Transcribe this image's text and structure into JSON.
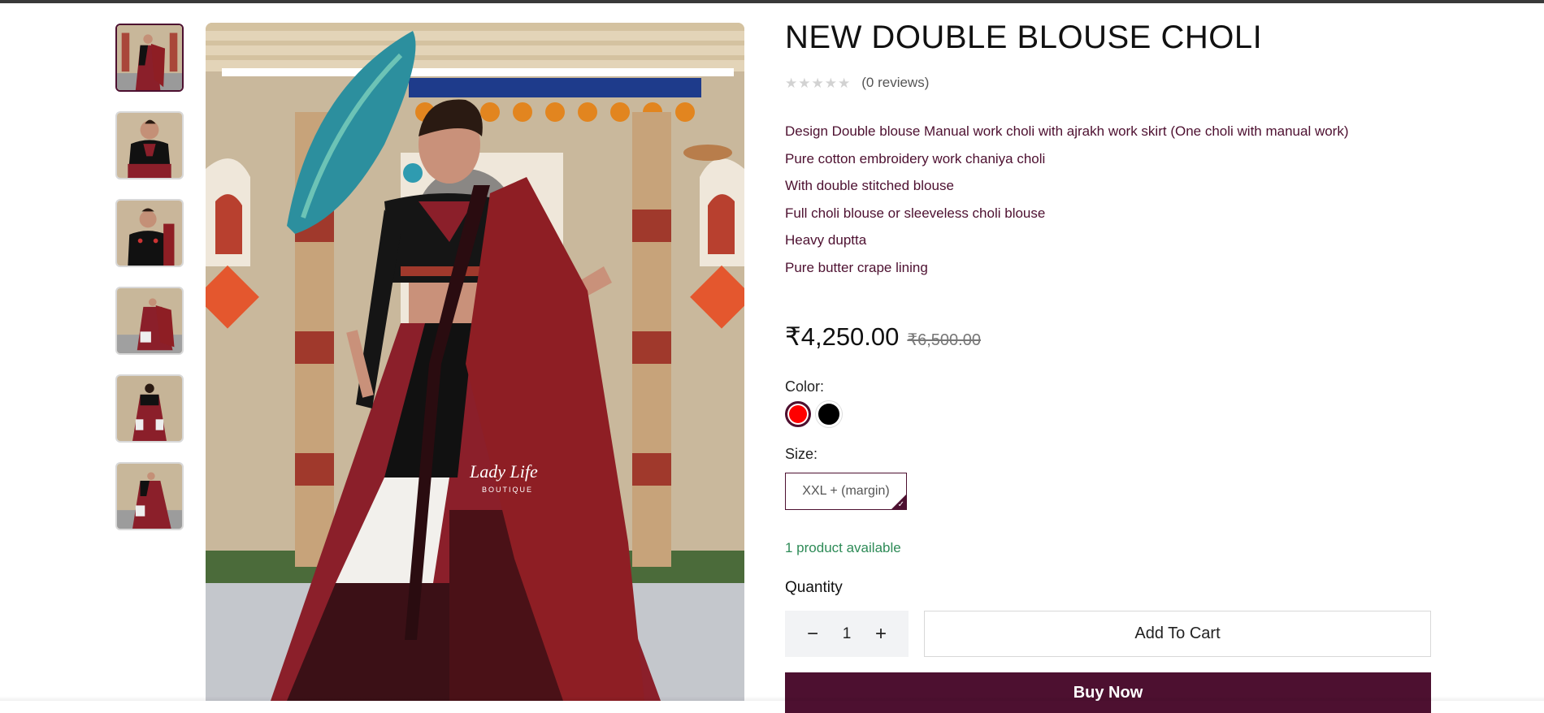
{
  "product": {
    "title": "NEW DOUBLE BLOUSE CHOLI",
    "rating": {
      "stars": 0,
      "max_stars": 5,
      "reviews_text": "(0 reviews)"
    },
    "description": [
      "Design Double blouse Manual work choli with ajrakh work skirt (One choli with manual  work)",
      "Pure cotton embroidery  work chaniya choli",
      "With double stitched blouse",
      "Full choli blouse or sleeveless choli blouse",
      "Heavy duptta",
      "Pure butter crape lining"
    ],
    "price": "₹4,250.00",
    "compare_price": "₹6,500.00",
    "color_label": "Color:",
    "colors": [
      {
        "name": "red",
        "hex": "#ff0000",
        "selected": true
      },
      {
        "name": "black",
        "hex": "#000000",
        "selected": false
      }
    ],
    "size_label": "Size:",
    "size_selected": "XXL + (margin)",
    "availability": "1 product available",
    "quantity_label": "Quantity",
    "quantity": "1",
    "add_to_cart_label": "Add To Cart",
    "buy_now_label": "Buy Now",
    "watermark_text": "Lady Life BOUTIQUE",
    "thumbnails_count": 6
  },
  "icons": {
    "star": "star-icon",
    "minus": "minus-icon",
    "plus": "plus-icon",
    "check": "checkmark-icon"
  },
  "glyphs": {
    "star": "★",
    "minus": "−",
    "plus": "+",
    "check": "✓"
  },
  "theme": {
    "brand": "#4d1030",
    "availability": "#2e8b57",
    "star_empty": "#d2d2d2"
  }
}
